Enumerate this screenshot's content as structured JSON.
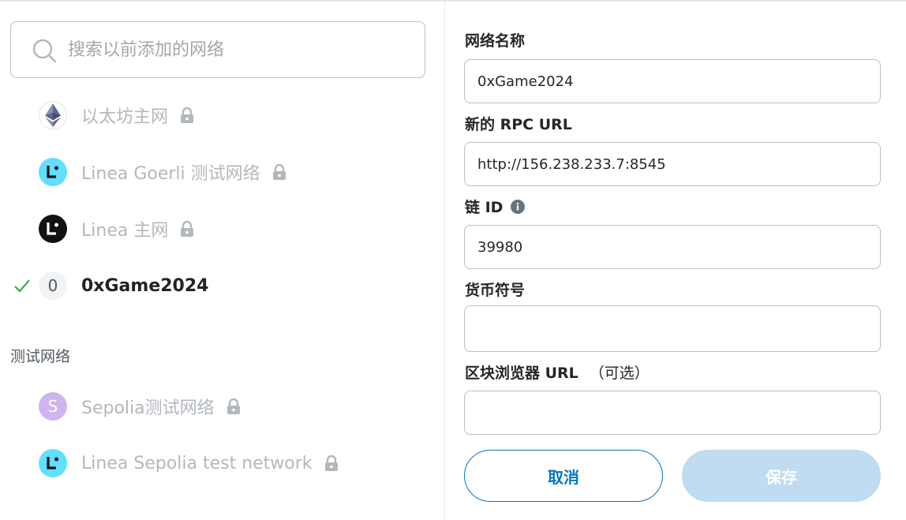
{
  "search": {
    "placeholder": "搜索以前添加的网络"
  },
  "networks": [
    {
      "label": "以太坊主网",
      "icon": "ethereum-icon",
      "locked": true,
      "selected": false
    },
    {
      "label": "Linea Goerli 测试网络",
      "icon": "linea-goerli-icon",
      "locked": true,
      "selected": false
    },
    {
      "label": "Linea 主网",
      "icon": "linea-mainnet-icon",
      "locked": true,
      "selected": false
    },
    {
      "label": "0xGame2024",
      "icon_letter": "0",
      "locked": false,
      "selected": true
    }
  ],
  "test_section": {
    "title": "测试网络",
    "networks": [
      {
        "label": "Sepolia测试网络",
        "icon_letter": "S",
        "locked": true
      },
      {
        "label": "Linea Sepolia test network",
        "icon": "linea-sepolia-icon",
        "locked": true
      }
    ]
  },
  "form": {
    "network_name": {
      "label": "网络名称",
      "value": "0xGame2024"
    },
    "rpc_url": {
      "label": "新的 RPC URL",
      "value": "http://156.238.233.7:8545"
    },
    "chain_id": {
      "label": "链 ID",
      "value": "39980"
    },
    "currency_symbol": {
      "label": "货币符号",
      "value": ""
    },
    "explorer_url": {
      "label": "区块浏览器 URL",
      "optional": "（可选）",
      "value": ""
    }
  },
  "buttons": {
    "cancel": "取消",
    "save": "保存"
  },
  "colors": {
    "primary": "#0376c9",
    "disabled_primary": "#bfdcf1",
    "muted_text": "#b3b8bd",
    "check_green": "#28a745",
    "linea_cyan": "#61dfff",
    "sepolia_purple": "#cfb5f0"
  }
}
